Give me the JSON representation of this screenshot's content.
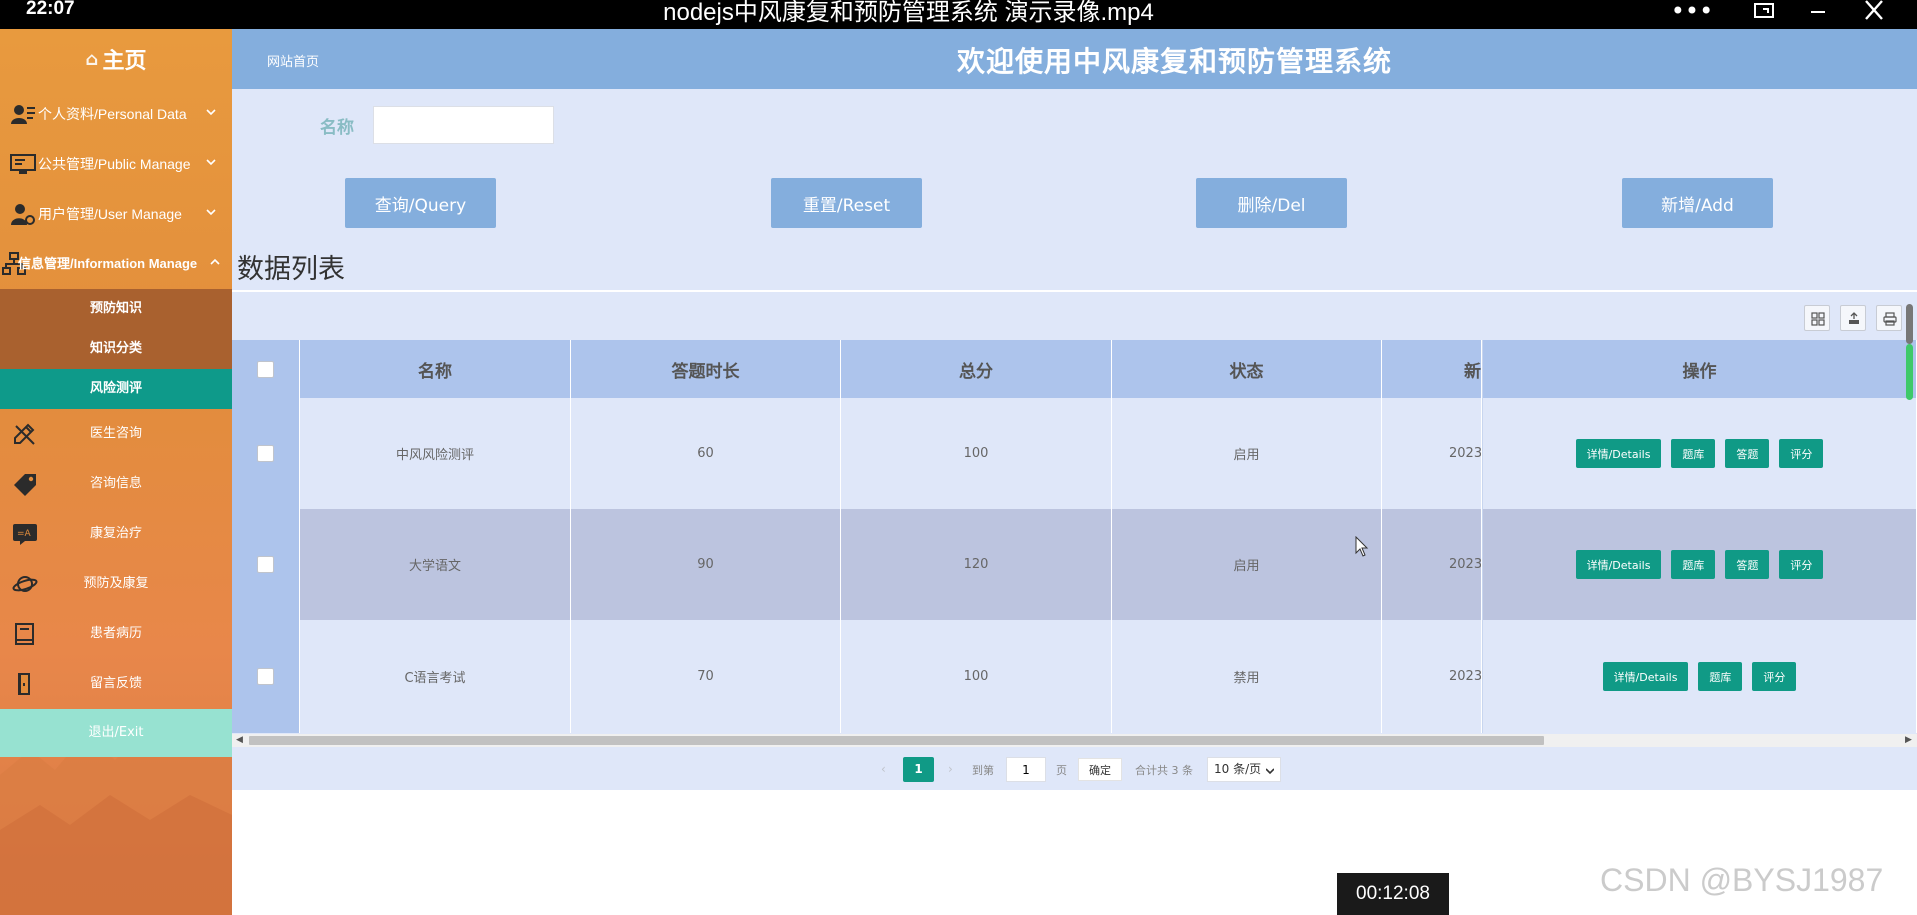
{
  "player": {
    "clock": "22:07",
    "title": "nodejs中风康复和预防管理系统 演示录像.mp4",
    "timestamp": "00:12:08",
    "watermark": "CSDN @BYSJ1987"
  },
  "sidebar": {
    "home_label": "主页",
    "groups": [
      {
        "label": "个人资料/Personal Data",
        "icon": "user-card-icon"
      },
      {
        "label": "公共管理/Public Manage",
        "icon": "monitor-icon"
      },
      {
        "label": "用户管理/User Manage",
        "icon": "user-gear-icon"
      },
      {
        "label": "信息管理/Information Manage",
        "icon": "network-icon"
      }
    ],
    "sub_items": [
      "预防知识",
      "知识分类",
      "风险测评"
    ],
    "active_sub": "风险测评",
    "items": [
      {
        "label": "医生咨询",
        "icon": "pencil-ruler-icon"
      },
      {
        "label": "咨询信息",
        "icon": "tag-icon"
      },
      {
        "label": "康复治疗",
        "icon": "translate-icon"
      },
      {
        "label": "预防及康复",
        "icon": "planet-icon"
      },
      {
        "label": "患者病历",
        "icon": "book-icon"
      },
      {
        "label": "留言反馈",
        "icon": "door-icon"
      }
    ],
    "exit_label": "退出/Exit"
  },
  "header": {
    "breadcrumb": "网站首页",
    "title": "欢迎使用中风康复和预防管理系统"
  },
  "search": {
    "label": "名称",
    "value": "",
    "placeholder": ""
  },
  "actions": {
    "query": "查询/Query",
    "reset": "重置/Reset",
    "delete": "删除/Del",
    "add": "新增/Add"
  },
  "list_title": "数据列表",
  "table": {
    "columns": [
      "名称",
      "答题时长",
      "总分",
      "状态",
      "新",
      "操作"
    ],
    "rows": [
      {
        "name": "中风风险测评",
        "duration": "60",
        "total": "100",
        "status": "启用",
        "date": "2023",
        "ops": [
          "详情/Details",
          "题库",
          "答题",
          "评分"
        ]
      },
      {
        "name": "大学语文",
        "duration": "90",
        "total": "120",
        "status": "启用",
        "date": "2023",
        "ops": [
          "详情/Details",
          "题库",
          "答题",
          "评分"
        ]
      },
      {
        "name": "C语言考试",
        "duration": "70",
        "total": "100",
        "status": "禁用",
        "date": "2023",
        "ops": [
          "详情/Details",
          "题库",
          "评分"
        ]
      }
    ]
  },
  "pager": {
    "current": "1",
    "goto_prefix": "到第",
    "goto_value": "1",
    "goto_suffix": "页",
    "confirm": "确定",
    "total": "合计共 3 条",
    "page_size": "10 条/页"
  },
  "colors": {
    "sidebar": "#e28d3c",
    "header": "#84aedd",
    "content_bg": "#dfe7f9",
    "active": "#0e9a8a",
    "op_button": "#109a86"
  }
}
